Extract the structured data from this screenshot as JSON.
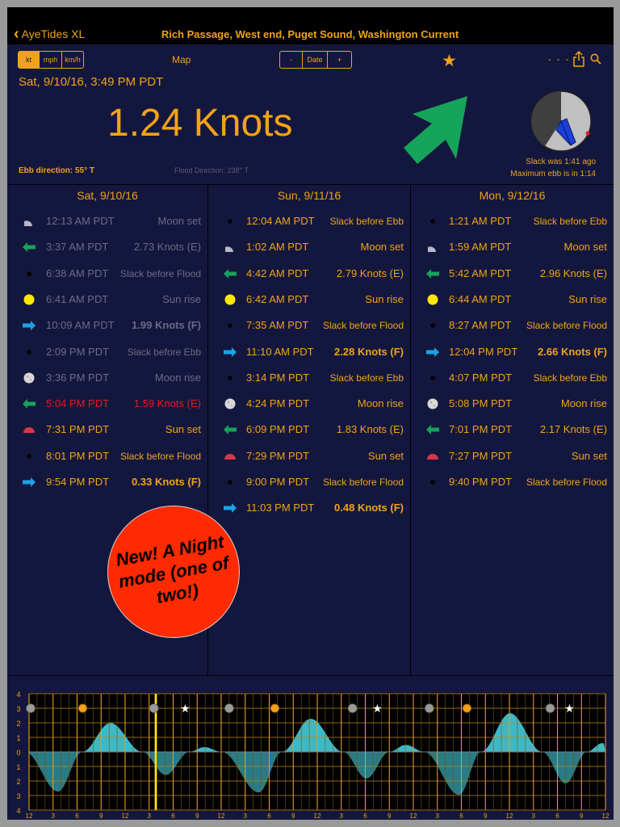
{
  "nav": {
    "back_label": "AyeTides XL",
    "title": "Rich Passage, West end, Puget Sound, Washington Current"
  },
  "toolbar": {
    "units": [
      {
        "label": "kt",
        "active": true
      },
      {
        "label": "mph",
        "active": false
      },
      {
        "label": "km/h",
        "active": false
      }
    ],
    "map_label": "Map",
    "date_minus": "-",
    "date_label": "Date",
    "date_plus": "+",
    "dashes": "- - -"
  },
  "current": {
    "time": "Sat, 9/10/16, 3:49 PM PDT",
    "speed": "1.24 Knots",
    "slack_was": "Slack was 1:41 ago",
    "max_ebb": "Maximum ebb is in 1:14",
    "ebb_direction": "Ebb direction: 55° T",
    "flood_direction": "Flood Direction: 238° T"
  },
  "colors": {
    "accent": "#f0a316",
    "background": "#14173d",
    "ebb_arrow": "#16a35a",
    "flood_arrow": "#1aa3e8",
    "past": "#6b6b86",
    "current_event": "#e8191e",
    "graph_fill": "#3cb8c8"
  },
  "days": [
    {
      "header": "Sat, 9/10/16",
      "events": [
        {
          "icon": "moon-set-icon",
          "time": "12:13 AM PDT",
          "desc": "Moon set",
          "state": "past"
        },
        {
          "icon": "ebb-arrow-icon",
          "time": "3:37 AM PDT",
          "desc": "2.73 Knots (E)",
          "state": "past"
        },
        {
          "icon": "slack-dot-icon",
          "time": "6:38 AM PDT",
          "desc": "Slack before Flood",
          "state": "past"
        },
        {
          "icon": "sun-rise-icon",
          "time": "6:41 AM PDT",
          "desc": "Sun rise",
          "state": "past"
        },
        {
          "icon": "flood-arrow-icon",
          "time": "10:09 AM PDT",
          "desc": "1.99 Knots (F)",
          "state": "past",
          "bold": true
        },
        {
          "icon": "slack-dot-icon",
          "time": "2:09 PM PDT",
          "desc": "Slack before Ebb",
          "state": "past"
        },
        {
          "icon": "moon-rise-icon",
          "time": "3:36 PM PDT",
          "desc": "Moon rise",
          "state": "past"
        },
        {
          "icon": "ebb-arrow-icon",
          "time": "5:04 PM PDT",
          "desc": "1.59 Knots (E)",
          "state": "next"
        },
        {
          "icon": "sun-set-icon",
          "time": "7:31 PM PDT",
          "desc": "Sun set",
          "state": "future"
        },
        {
          "icon": "slack-dot-icon",
          "time": "8:01 PM PDT",
          "desc": "Slack before Flood",
          "state": "future"
        },
        {
          "icon": "flood-arrow-icon",
          "time": "9:54 PM PDT",
          "desc": "0.33 Knots (F)",
          "state": "future",
          "bold": true
        }
      ]
    },
    {
      "header": "Sun, 9/11/16",
      "events": [
        {
          "icon": "slack-dot-icon",
          "time": "12:04 AM PDT",
          "desc": "Slack before Ebb",
          "state": "future"
        },
        {
          "icon": "moon-set-icon",
          "time": "1:02 AM PDT",
          "desc": "Moon set",
          "state": "future"
        },
        {
          "icon": "ebb-arrow-icon",
          "time": "4:42 AM PDT",
          "desc": "2.79 Knots (E)",
          "state": "future"
        },
        {
          "icon": "sun-rise-icon",
          "time": "6:42 AM PDT",
          "desc": "Sun rise",
          "state": "future"
        },
        {
          "icon": "slack-dot-icon",
          "time": "7:35 AM PDT",
          "desc": "Slack before Flood",
          "state": "future"
        },
        {
          "icon": "flood-arrow-icon",
          "time": "11:10 AM PDT",
          "desc": "2.28 Knots (F)",
          "state": "future",
          "bold": true
        },
        {
          "icon": "slack-dot-icon",
          "time": "3:14 PM PDT",
          "desc": "Slack before Ebb",
          "state": "future"
        },
        {
          "icon": "moon-rise-icon",
          "time": "4:24 PM PDT",
          "desc": "Moon rise",
          "state": "future"
        },
        {
          "icon": "ebb-arrow-icon",
          "time": "6:09 PM PDT",
          "desc": "1.83 Knots (E)",
          "state": "future"
        },
        {
          "icon": "sun-set-icon",
          "time": "7:29 PM PDT",
          "desc": "Sun set",
          "state": "future"
        },
        {
          "icon": "slack-dot-icon",
          "time": "9:00 PM PDT",
          "desc": "Slack before Flood",
          "state": "future"
        },
        {
          "icon": "flood-arrow-icon",
          "time": "11:03 PM PDT",
          "desc": "0.48 Knots (F)",
          "state": "future",
          "bold": true
        }
      ]
    },
    {
      "header": "Mon, 9/12/16",
      "events": [
        {
          "icon": "slack-dot-icon",
          "time": "1:21 AM PDT",
          "desc": "Slack before Ebb",
          "state": "future"
        },
        {
          "icon": "moon-set-icon",
          "time": "1:59 AM PDT",
          "desc": "Moon set",
          "state": "future"
        },
        {
          "icon": "ebb-arrow-icon",
          "time": "5:42 AM PDT",
          "desc": "2.96 Knots (E)",
          "state": "future"
        },
        {
          "icon": "sun-rise-icon",
          "time": "6:44 AM PDT",
          "desc": "Sun rise",
          "state": "future"
        },
        {
          "icon": "slack-dot-icon",
          "time": "8:27 AM PDT",
          "desc": "Slack before Flood",
          "state": "future"
        },
        {
          "icon": "flood-arrow-icon",
          "time": "12:04 PM PDT",
          "desc": "2.66 Knots (F)",
          "state": "future",
          "bold": true
        },
        {
          "icon": "slack-dot-icon",
          "time": "4:07 PM PDT",
          "desc": "Slack before Ebb",
          "state": "future"
        },
        {
          "icon": "moon-rise-icon",
          "time": "5:08 PM PDT",
          "desc": "Moon rise",
          "state": "future"
        },
        {
          "icon": "ebb-arrow-icon",
          "time": "7:01 PM PDT",
          "desc": "2.17 Knots (E)",
          "state": "future"
        },
        {
          "icon": "sun-set-icon",
          "time": "7:27 PM PDT",
          "desc": "Sun set",
          "state": "future"
        },
        {
          "icon": "slack-dot-icon",
          "time": "9:40 PM PDT",
          "desc": "Slack before Flood",
          "state": "future"
        }
      ]
    }
  ],
  "promo": {
    "text": "New! A Night mode (one of two!)"
  },
  "graph": {
    "y_labels": [
      "4",
      "3",
      "2",
      "1",
      "0",
      "1",
      "2",
      "3",
      "4"
    ],
    "x_labels": [
      "12",
      "3",
      "6",
      "9",
      "12",
      "3",
      "6",
      "9",
      "12",
      "3",
      "6",
      "9",
      "12",
      "3",
      "6",
      "9",
      "12",
      "3",
      "6",
      "9",
      "12",
      "3",
      "6",
      "9",
      "12"
    ],
    "now_hour": 15.82,
    "ebb": [
      [
        3.62,
        2.73
      ],
      [
        17.07,
        1.59
      ],
      [
        28.7,
        2.79
      ],
      [
        42.15,
        1.83
      ],
      [
        53.7,
        2.96
      ],
      [
        67.02,
        2.17
      ]
    ],
    "flood": [
      [
        10.15,
        1.99
      ],
      [
        21.9,
        0.33
      ],
      [
        35.17,
        2.28
      ],
      [
        47.05,
        0.48
      ],
      [
        60.07,
        2.66
      ],
      [
        71.6,
        0.6
      ]
    ],
    "slack": [
      -0.5,
      6.63,
      14.15,
      20.02,
      24.07,
      31.58,
      39.23,
      45.0,
      49.35,
      56.45,
      64.12,
      69.67
    ],
    "icons": [
      {
        "kind": "moon",
        "hour": 0.2
      },
      {
        "kind": "sun",
        "hour": 6.7
      },
      {
        "kind": "moon",
        "hour": 15.6
      },
      {
        "kind": "star",
        "hour": 19.5
      },
      {
        "kind": "moon",
        "hour": 25.0
      },
      {
        "kind": "sun",
        "hour": 30.7
      },
      {
        "kind": "moon",
        "hour": 40.4
      },
      {
        "kind": "star",
        "hour": 43.5
      },
      {
        "kind": "moon",
        "hour": 50.0
      },
      {
        "kind": "sun",
        "hour": 54.7
      },
      {
        "kind": "moon",
        "hour": 65.1
      },
      {
        "kind": "star",
        "hour": 67.5
      }
    ]
  }
}
